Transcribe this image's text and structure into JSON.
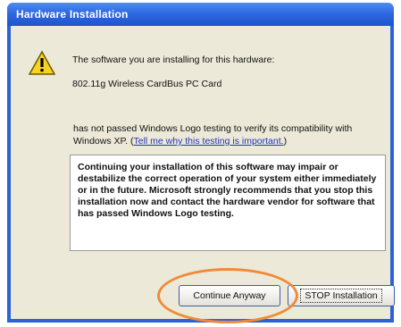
{
  "window": {
    "title": "Hardware Installation"
  },
  "icon": {
    "warning": "warning-icon"
  },
  "message": {
    "line1": "The software you are installing for this hardware:",
    "device": "802.11g Wireless CardBus PC Card",
    "para_before_link": "has not passed Windows Logo testing to verify its compatibility with Windows XP. (",
    "link": "Tell me why this testing is important.",
    "para_after_link": ")",
    "warning": "Continuing your installation of this software may impair or destabilize the correct operation of your system either immediately or in the future. Microsoft strongly recommends that you stop this installation now and contact the hardware vendor for software that has passed Windows Logo testing."
  },
  "buttons": {
    "continue": "Continue Anyway",
    "stop": "STOP Installation"
  },
  "colors": {
    "titlebar": "#2e68e0",
    "highlight": "#ef8a39",
    "client": "#ece9d8"
  }
}
